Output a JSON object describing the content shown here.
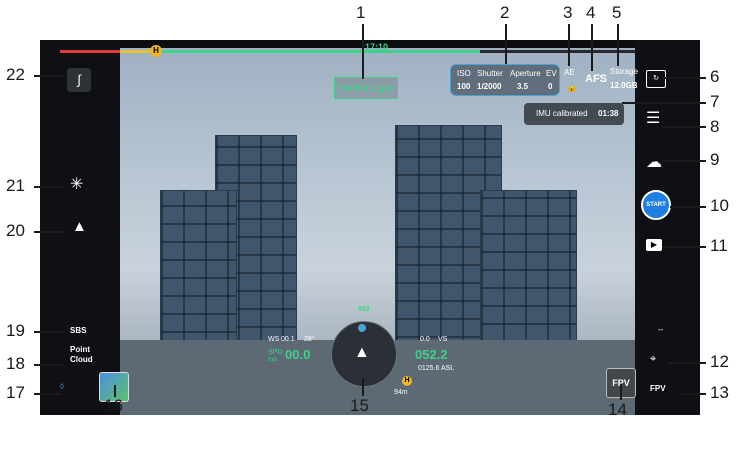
{
  "status_bar": {
    "flight_time": "17:10",
    "home_marker": "H"
  },
  "camera": {
    "mode_label": "Visible Light",
    "params": [
      {
        "label": "ISO",
        "value": "100"
      },
      {
        "label": "Shutter",
        "value": "1/2000"
      },
      {
        "label": "Aperture",
        "value": "3.5"
      },
      {
        "label": "EV",
        "value": "0"
      }
    ],
    "ae_label": "AE",
    "focus_mode": "AFS",
    "storage_label": "Storage",
    "storage_value": "12.0GB"
  },
  "notification": {
    "message": "IMU calibrated",
    "time": "01:38"
  },
  "right_controls": {
    "start_label": "START",
    "fpv_label": "FPV",
    "dash": "--"
  },
  "left_controls": {
    "sbs_label": "SBS",
    "point_cloud_label": "Point\nCloud"
  },
  "telemetry": {
    "ws_label": "WS",
    "ws_value": "00.1",
    "ws_dir": "28°",
    "spd_label": "SPD",
    "spd_unit": "m/s",
    "spd_value": "00.0",
    "vs_value": "0.0",
    "vs_label": "VS",
    "alt_value": "052.2",
    "alt_asl": "0125.6 ASL",
    "heading": "003",
    "home_distance": "94m"
  },
  "icons": {
    "flight_route": "route-icon",
    "lighting": "sun-burst-icon",
    "gps_arrow": "navigation-arrow-icon",
    "camera_switch": "camera-switch-icon",
    "settings": "sliders-icon",
    "cloud": "cloud-sync-icon",
    "playback": "playback-icon",
    "zoom": "zoom-icon",
    "map": "map-pin-icon"
  },
  "callouts": [
    "1",
    "2",
    "3",
    "4",
    "5",
    "6",
    "7",
    "8",
    "9",
    "10",
    "11",
    "12",
    "13",
    "14",
    "15",
    "16",
    "17",
    "18",
    "19",
    "20",
    "21",
    "22"
  ],
  "colors": {
    "accent_green": "#3fd18b",
    "accent_blue": "#1f7fe0",
    "warning_yellow": "#f0b428",
    "alert_red": "#e23b3b"
  }
}
